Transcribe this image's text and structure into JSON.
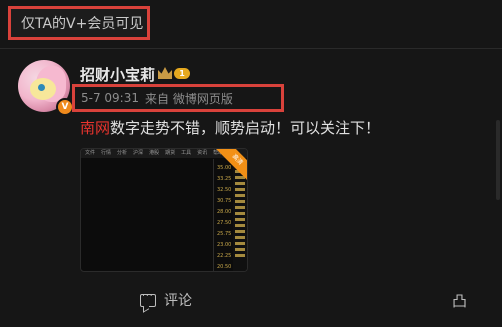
{
  "banner": {
    "text": "仅TA的V+会员可见"
  },
  "post": {
    "username": "招财小宝莉",
    "level_badge": "1",
    "verified_badge": "V",
    "date": "5-7 09:31",
    "source": "来自 微博网页版",
    "text_highlight": "南网",
    "text_rest": "数字走势不错，顺势启动！可以关注下！",
    "image": {
      "menu_items": [
        "文件",
        "行情",
        "分析",
        "沪深",
        "港股",
        "期货",
        "工具",
        "资讯",
        "帮助"
      ],
      "ribbon": "高清",
      "scale_values": [
        "35.00",
        "33.25",
        "32.50",
        "30.75",
        "28.00",
        "27.50",
        "25.75",
        "23.00",
        "22.25",
        "20.50"
      ]
    }
  },
  "actions": {
    "comment_label": "评论",
    "like_label": "凸"
  },
  "colors": {
    "accent_red": "#e8342e",
    "box_red": "#d9423b",
    "badge_orange": "#f08a1c"
  }
}
